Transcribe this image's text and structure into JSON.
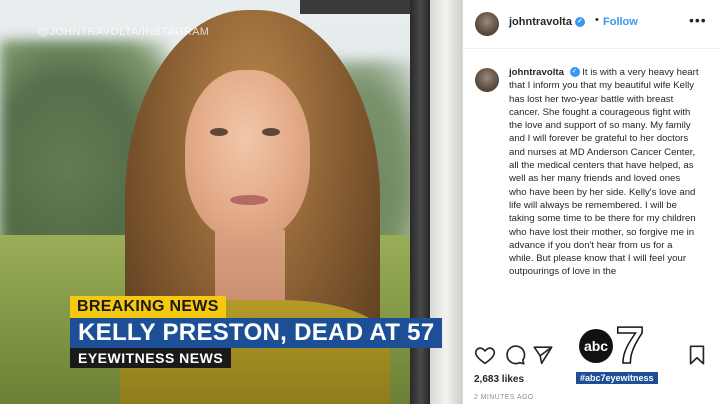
{
  "watermark": "@JOHNTRAVOLTA/INSTAGRAM",
  "news": {
    "label": "BREAKING NEWS",
    "headline": "KELLY PRESTON, DEAD AT 57",
    "program": "EYEWITNESS NEWS"
  },
  "post": {
    "username": "johntravolta",
    "follow_label": "Follow",
    "more_label": "•••",
    "caption_user": "johntravolta",
    "caption_body": "It is with a very heavy heart that I inform you that my beautiful wife Kelly has lost her two-year battle with breast cancer. She fought a courageous fight with the love and support of so many.  My family and I will forever be grateful to her doctors and nurses at MD Anderson Cancer Center, all the medical centers that have helped, as well as her many friends and loved ones who have been by her side. Kelly's love and life will always be remembered. I will be taking some time to be there for my children who have lost their mother, so forgive me in advance if you don't hear from us for a while.  But please know that I will feel your outpourings of love in the",
    "likes": "2,683 likes",
    "time_ago": "2 MINUTES AGO"
  },
  "station": {
    "hashtag": "#abc7eyewitness",
    "logo_text": "abc",
    "logo_number": "7"
  },
  "colors": {
    "breaking_yellow": "#f6c90e",
    "headline_blue": "#1d4f96",
    "instagram_blue": "#3897f0"
  }
}
